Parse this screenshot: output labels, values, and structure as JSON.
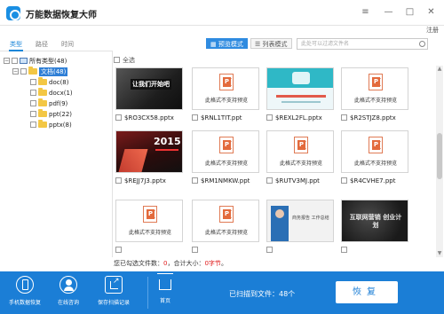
{
  "app": {
    "title": "万能数据恢复大师",
    "login_label": "注册",
    "window_controls": {
      "menu": "≡",
      "minimize": "—",
      "maximize": "□",
      "close": "✕"
    }
  },
  "left_tabs": [
    {
      "label": "类型",
      "active": true
    },
    {
      "label": "路径",
      "active": false
    },
    {
      "label": "时间",
      "active": false
    }
  ],
  "tree": {
    "root": {
      "label": "所有类型(48)"
    },
    "category": {
      "label": "文档(48)",
      "selected": true
    },
    "children": [
      {
        "label": "doc(8)"
      },
      {
        "label": "docx(1)"
      },
      {
        "label": "pdf(9)"
      },
      {
        "label": "ppt(22)"
      },
      {
        "label": "pptx(8)"
      }
    ]
  },
  "toolbar": {
    "preview_mode_label": "预览模式",
    "list_mode_label": "列表模式",
    "search_placeholder": "此处可以过滤文件名"
  },
  "select_all_label": "全选",
  "unsupported_text": "此格式不支持预览",
  "files": [
    {
      "name": "$RO3CX58.pptx",
      "preview": "让我们开始吧"
    },
    {
      "name": "$RNL1TIT.ppt",
      "preview": "unsupported"
    },
    {
      "name": "$REXL2FL.pptx",
      "preview": "banner"
    },
    {
      "name": "$R2STJZ8.pptx",
      "preview": "unsupported"
    },
    {
      "name": "$REJJ7J3.pptx",
      "preview": "2015"
    },
    {
      "name": "$RM1NMKW.ppt",
      "preview": "unsupported"
    },
    {
      "name": "$RUTV3MJ.ppt",
      "preview": "unsupported"
    },
    {
      "name": "$R4CVHE7.ppt",
      "preview": "unsupported"
    },
    {
      "name": "",
      "preview": "unsupported"
    },
    {
      "name": "",
      "preview": "unsupported"
    },
    {
      "name": "",
      "preview": "商务报告 工作总结"
    },
    {
      "name": "",
      "preview": "互联网营销 创业计划"
    }
  ],
  "status": {
    "prefix": "您已勾选文件数：",
    "count": "0",
    "middle": "，合计大小：",
    "size": "0字节",
    "suffix": "。"
  },
  "bottom": {
    "phone_recovery": "手机数据恢复",
    "online_consult": "在线咨询",
    "save_scan": "保存扫描记录",
    "home": "首页",
    "scan_result": "已扫描到文件：48个",
    "recover": "恢复"
  }
}
